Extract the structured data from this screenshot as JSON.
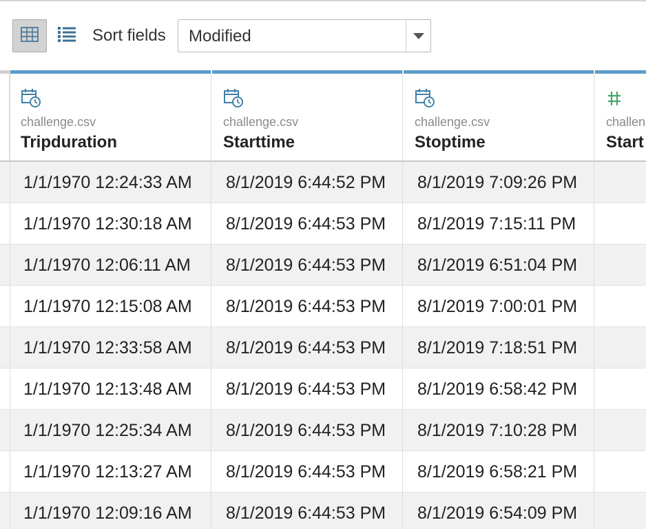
{
  "toolbar": {
    "grid_view_icon": "grid-view-icon",
    "list_view_icon": "list-view-icon",
    "sort_label": "Sort fields",
    "sort_value": "Modified"
  },
  "columns": [
    {
      "source": "challenge.csv",
      "name": "Tripduration",
      "type_icon": "calendar-clock-icon"
    },
    {
      "source": "challenge.csv",
      "name": "Starttime",
      "type_icon": "calendar-clock-icon"
    },
    {
      "source": "challenge.csv",
      "name": "Stoptime",
      "type_icon": "calendar-clock-icon"
    },
    {
      "source": "challen",
      "name": "Start",
      "type_icon": "number-hash-icon"
    }
  ],
  "rows": [
    [
      "1/1/1970 12:24:33 AM",
      "8/1/2019 6:44:52 PM",
      "8/1/2019 7:09:26 PM",
      ""
    ],
    [
      "1/1/1970 12:30:18 AM",
      "8/1/2019 6:44:53 PM",
      "8/1/2019 7:15:11 PM",
      ""
    ],
    [
      "1/1/1970 12:06:11 AM",
      "8/1/2019 6:44:53 PM",
      "8/1/2019 6:51:04 PM",
      ""
    ],
    [
      "1/1/1970 12:15:08 AM",
      "8/1/2019 6:44:53 PM",
      "8/1/2019 7:00:01 PM",
      ""
    ],
    [
      "1/1/1970 12:33:58 AM",
      "8/1/2019 6:44:53 PM",
      "8/1/2019 7:18:51 PM",
      ""
    ],
    [
      "1/1/1970 12:13:48 AM",
      "8/1/2019 6:44:53 PM",
      "8/1/2019 6:58:42 PM",
      ""
    ],
    [
      "1/1/1970 12:25:34 AM",
      "8/1/2019 6:44:53 PM",
      "8/1/2019 7:10:28 PM",
      ""
    ],
    [
      "1/1/1970 12:13:27 AM",
      "8/1/2019 6:44:53 PM",
      "8/1/2019 6:58:21 PM",
      ""
    ],
    [
      "1/1/1970 12:09:16 AM",
      "8/1/2019 6:44:53 PM",
      "8/1/2019 6:54:09 PM",
      ""
    ]
  ],
  "colors": {
    "header_accent": "#5c9bc8",
    "date_icon": "#3f7fa8",
    "number_icon": "#4aa36a",
    "row_shade": "#f1f1f1"
  }
}
